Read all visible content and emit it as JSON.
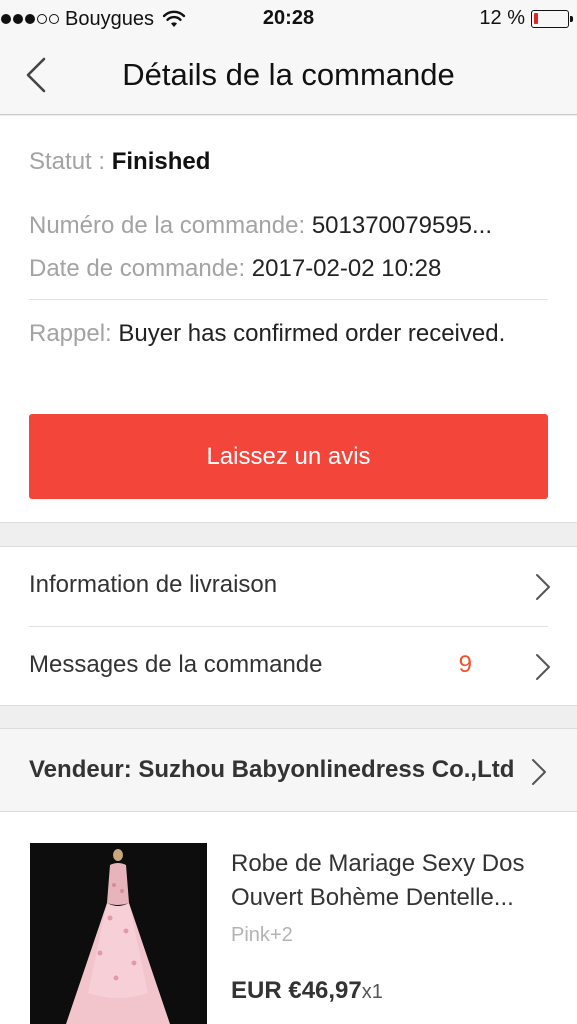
{
  "status_bar": {
    "carrier": "Bouygues",
    "time": "20:28",
    "battery": "12 %",
    "battery_level": 0.12,
    "signal_dots_filled": 3,
    "signal_dots_total": 5
  },
  "nav": {
    "title": "Détails de la commande",
    "back_icon": "chevron-left-icon"
  },
  "order": {
    "status_label": "Statut :",
    "status_value": "Finished",
    "number_label": "Numéro de la commande:",
    "number_value": "501370079595...",
    "date_label": "Date de commande:",
    "date_value": "2017-02-02 10:28",
    "reminder_label": "Rappel:",
    "reminder_value": "Buyer has confirmed order received.",
    "action_label": "Laissez un avis"
  },
  "menu": {
    "shipping_label": "Information de livraison",
    "messages_label": "Messages de la commande",
    "messages_count": "9"
  },
  "seller": {
    "label": "Vendeur: Suzhou Babyonlinedress Co.,Ltd"
  },
  "product": {
    "title": "Robe de Mariage Sexy Dos Ouvert Bohème Dentelle...",
    "variant": "Pink+2",
    "price": "EUR €46,97",
    "quantity": "x1"
  },
  "colors": {
    "accent": "#f4453a",
    "count": "#f0512e",
    "battery_low": "#e02525"
  }
}
